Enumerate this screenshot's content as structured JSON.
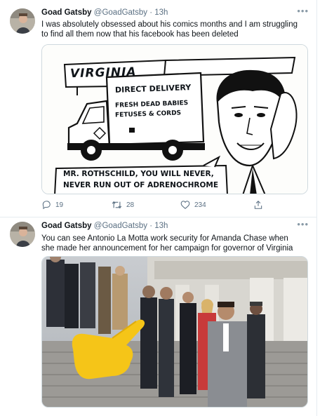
{
  "tweets": [
    {
      "name": "Goad Gatsby",
      "handle": "@GoadGatsby",
      "time": "· 13h",
      "text": "I was absolutely obsessed about his comics months and I am struggling to find all them now that his facebook has been deleted",
      "cartoon": {
        "sign": "VIRGINIA",
        "truck_line1": "DIRECT DELIVERY",
        "truck_line2": "FRESH DEAD BABIES",
        "truck_line3": "FETUSES & CORDS",
        "speech_line1": "MR. ROTHSCHILD,  YOU WILL NEVER,",
        "speech_line2": "NEVER RUN OUT OF ADRENOCHROME"
      },
      "actions": {
        "replies": "19",
        "retweets": "28",
        "likes": "234"
      }
    },
    {
      "name": "Goad Gatsby",
      "handle": "@GoadGatsby",
      "time": "· 13h",
      "text": "You can see Antonio La Motta work security for Amanda Chase when she made her announcement for her campaign for governor of Virginia"
    }
  ],
  "icons": {
    "more": "more-icon",
    "reply": "reply-icon",
    "retweet": "retweet-icon",
    "like": "like-icon",
    "share": "share-icon",
    "pointer": "pointing-hand-icon"
  },
  "colors": {
    "text": "#0f1419",
    "secondary": "#5b7083",
    "border": "#e6ecf0",
    "emoji": "#f5c518"
  }
}
